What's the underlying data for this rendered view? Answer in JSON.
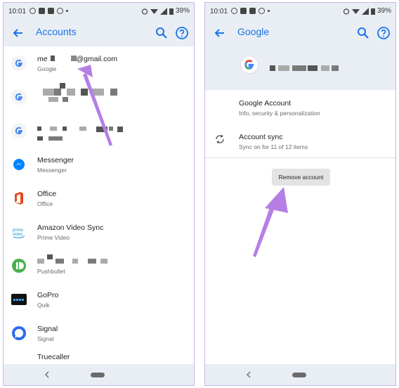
{
  "status": {
    "time": "10:01",
    "battery": "39%"
  },
  "left": {
    "title": "Accounts",
    "accounts": [
      {
        "title": "me",
        "title_suffix": "@gmail.com",
        "subtitle": "Google",
        "icon": "google-icon"
      },
      {
        "title": "",
        "subtitle": "",
        "icon": "google-icon"
      },
      {
        "title": "",
        "subtitle": "",
        "icon": "google-icon"
      },
      {
        "title": "Messenger",
        "subtitle": "Messenger",
        "icon": "messenger-icon"
      },
      {
        "title": "Office",
        "subtitle": "Office",
        "icon": "office-icon"
      },
      {
        "title": "Amazon Video Sync",
        "subtitle": "Prime Video",
        "icon": "prime-video-icon"
      },
      {
        "title": "",
        "subtitle": "Pushbullet",
        "icon": "pushbullet-icon"
      },
      {
        "title": "GoPro",
        "subtitle": "Quik",
        "icon": "gopro-icon"
      },
      {
        "title": "Signal",
        "subtitle": "Signal",
        "icon": "signal-icon"
      },
      {
        "title": "Truecaller",
        "subtitle": "",
        "icon": "truecaller-icon"
      }
    ]
  },
  "right": {
    "title": "Google",
    "items": [
      {
        "title": "Google Account",
        "subtitle": "Info, security & personalization"
      },
      {
        "title": "Account sync",
        "subtitle": "Sync on for 11 of 12 items"
      }
    ],
    "remove_label": "Remove account"
  },
  "colors": {
    "accent": "#1a73e8",
    "appbar": "#e9eef5",
    "arrow": "#b57fe6"
  }
}
